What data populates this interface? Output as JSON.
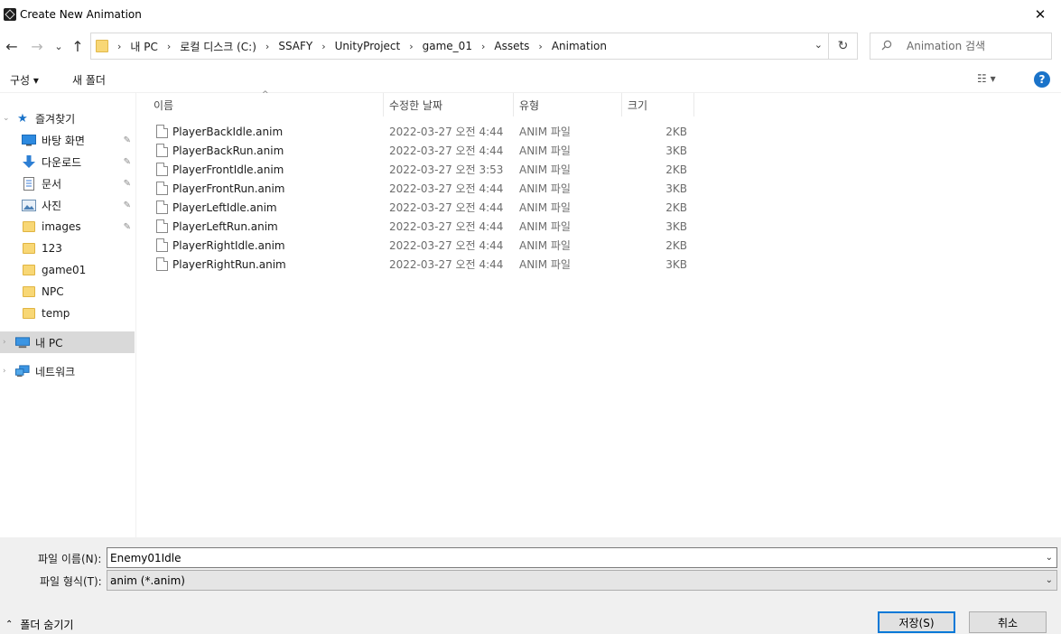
{
  "window": {
    "title": "Create New Animation",
    "close_glyph": "✕"
  },
  "nav": {
    "back_glyph": "←",
    "forward_glyph": "→",
    "recent_glyph": "⌄",
    "up_glyph": "↑",
    "breadcrumbs": [
      "내 PC",
      "로컬 디스크 (C:)",
      "SSAFY",
      "UnityProject",
      "game_01",
      "Assets",
      "Animation"
    ],
    "crumb_sep": "›",
    "dropdown_glyph": "⌄",
    "refresh_glyph": "↻",
    "search_placeholder": "Animation 검색"
  },
  "commands": {
    "organize": "구성 ▾",
    "new_folder": "새 폴더",
    "view_glyph": "☷ ▾",
    "help": "?"
  },
  "sidebar": {
    "quick_access": "즐겨찾기",
    "items": [
      {
        "label": "바탕 화면",
        "icon": "desktop-icon",
        "pinned": true
      },
      {
        "label": "다운로드",
        "icon": "download-icon",
        "pinned": true
      },
      {
        "label": "문서",
        "icon": "document-icon",
        "pinned": true
      },
      {
        "label": "사진",
        "icon": "pictures-icon",
        "pinned": true
      },
      {
        "label": "images",
        "icon": "folder-icon",
        "pinned": true
      },
      {
        "label": "123",
        "icon": "folder-icon",
        "pinned": false
      },
      {
        "label": "game01",
        "icon": "folder-icon",
        "pinned": false
      },
      {
        "label": "NPC",
        "icon": "folder-icon",
        "pinned": false
      },
      {
        "label": "temp",
        "icon": "folder-icon",
        "pinned": false
      }
    ],
    "this_pc": "내 PC",
    "network": "네트워크",
    "pin_glyph": "📌"
  },
  "columns": {
    "name": "이름",
    "date": "수정한 날짜",
    "type": "유형",
    "size": "크기"
  },
  "files": [
    {
      "name": "PlayerBackIdle.anim",
      "date": "2022-03-27 오전 4:44",
      "type": "ANIM 파일",
      "size": "2KB"
    },
    {
      "name": "PlayerBackRun.anim",
      "date": "2022-03-27 오전 4:44",
      "type": "ANIM 파일",
      "size": "3KB"
    },
    {
      "name": "PlayerFrontIdle.anim",
      "date": "2022-03-27 오전 3:53",
      "type": "ANIM 파일",
      "size": "2KB"
    },
    {
      "name": "PlayerFrontRun.anim",
      "date": "2022-03-27 오전 4:44",
      "type": "ANIM 파일",
      "size": "3KB"
    },
    {
      "name": "PlayerLeftIdle.anim",
      "date": "2022-03-27 오전 4:44",
      "type": "ANIM 파일",
      "size": "2KB"
    },
    {
      "name": "PlayerLeftRun.anim",
      "date": "2022-03-27 오전 4:44",
      "type": "ANIM 파일",
      "size": "3KB"
    },
    {
      "name": "PlayerRightIdle.anim",
      "date": "2022-03-27 오전 4:44",
      "type": "ANIM 파일",
      "size": "2KB"
    },
    {
      "name": "PlayerRightRun.anim",
      "date": "2022-03-27 오전 4:44",
      "type": "ANIM 파일",
      "size": "3KB"
    }
  ],
  "form": {
    "filename_label": "파일 이름(N):",
    "filename_value": "Enemy01Idle",
    "filetype_label": "파일 형식(T):",
    "filetype_value": "anim (*.anim)",
    "hide_folders": "폴더 숨기기",
    "save": "저장(S)",
    "cancel": "취소"
  },
  "colors": {
    "accent": "#0078d7",
    "selected": "#d9d9d9",
    "form_bg": "#f0f0f0"
  }
}
